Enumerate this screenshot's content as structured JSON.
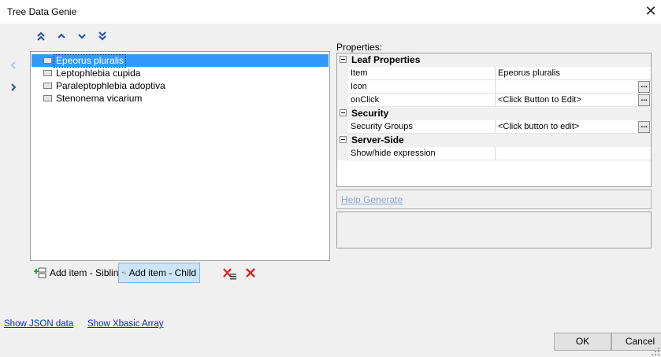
{
  "window": {
    "title": "Tree Data Genie"
  },
  "tree": {
    "items": [
      {
        "label": "Epeorus pluralis",
        "selected": true
      },
      {
        "label": "Leptophlebia cupida",
        "selected": false
      },
      {
        "label": "Paraleptophlebia adoptiva",
        "selected": false
      },
      {
        "label": "Stenonema vicarium",
        "selected": false
      }
    ]
  },
  "toolbar": {
    "add_sibling": "Add item - Sibling",
    "add_child": "Add item - Child"
  },
  "properties": {
    "label": "Properties:",
    "categories": [
      {
        "name": "Leaf Properties",
        "rows": [
          {
            "name": "Item",
            "value": "Epeorus pluralis",
            "has_button": false
          },
          {
            "name": "Icon",
            "value": "",
            "has_button": true
          },
          {
            "name": "onClick",
            "value": "<Click Button to Edit>",
            "has_button": true
          }
        ]
      },
      {
        "name": "Security",
        "rows": [
          {
            "name": "Security Groups",
            "value": "<Click button to edit>",
            "has_button": true
          }
        ]
      },
      {
        "name": "Server-Side",
        "rows": [
          {
            "name": "Show/hide expression",
            "value": "",
            "has_button": false
          }
        ]
      }
    ],
    "ellipsis": "..."
  },
  "help": {
    "generate": "Help Generate"
  },
  "links": {
    "show_json": "Show JSON data",
    "show_xbasic": "Show Xbasic Array"
  },
  "buttons": {
    "ok": "OK",
    "cancel": "Cancel"
  },
  "colors": {
    "selection": "#3399ff",
    "link": "#0b2bb8",
    "nav_arrow": "#1f4fa8"
  }
}
